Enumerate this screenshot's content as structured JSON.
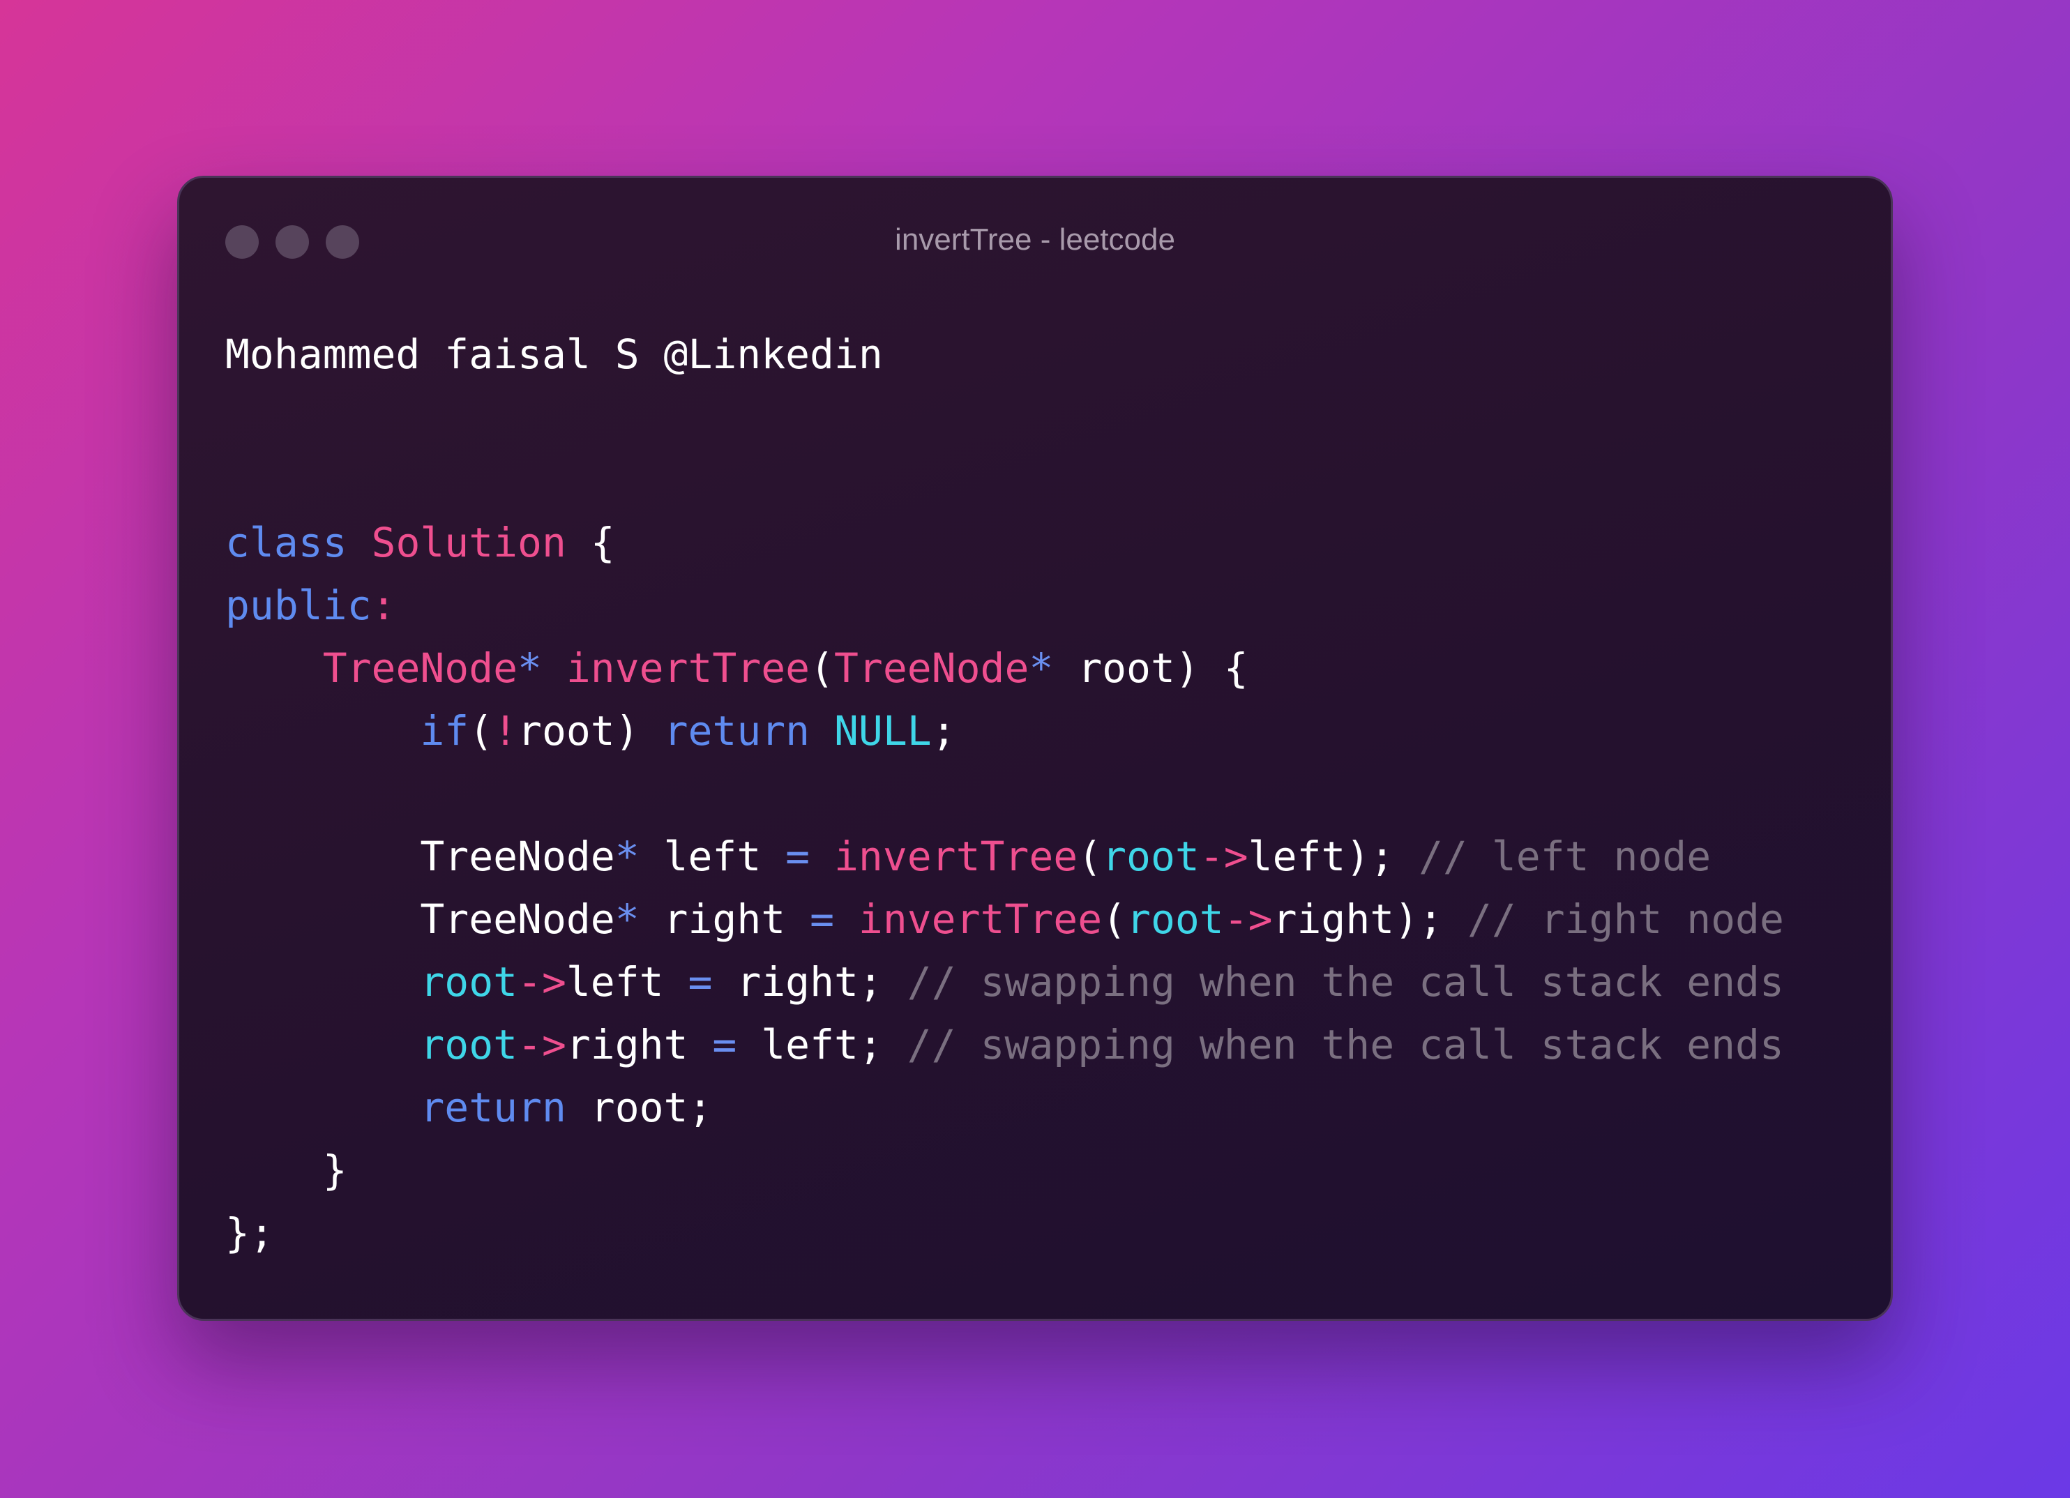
{
  "window": {
    "title": "invertTree - leetcode"
  },
  "colors": {
    "keyword": "#5f8bf0",
    "type": "#ef4f8f",
    "operator": "#6a8ff0",
    "member": "#3fd6e8",
    "comment": "#7a6f80",
    "text": "#ffffff"
  },
  "code": {
    "author_line": "Mohammed faisal S @Linkedin",
    "l1": {
      "kw": "class",
      "name": "Solution",
      "brace": " {"
    },
    "l2": {
      "kw": "public",
      "colon": ":"
    },
    "l3": {
      "type": "TreeNode",
      "star": "*",
      "fn": "invertTree",
      "open": "(",
      "ptype": "TreeNode",
      "pstar": "*",
      "rest": " root) {"
    },
    "l4": {
      "kw_if": "if",
      "open": "(",
      "not": "!",
      "var": "root)",
      "kw_ret": "return",
      "null": "NULL",
      "semi": ";"
    },
    "l5": {
      "type": "TreeNode",
      "star": "*",
      "var": " left ",
      "eq": "=",
      "fn": "invertTree",
      "open": "(",
      "obj": "root",
      "arrow": "->",
      "member": "left);",
      "comment": "// left node"
    },
    "l6": {
      "type": "TreeNode",
      "star": "*",
      "var": " right ",
      "eq": "=",
      "fn": "invertTree",
      "open": "(",
      "obj": "root",
      "arrow": "->",
      "member": "right);",
      "comment": "// right node"
    },
    "l7": {
      "obj": "root",
      "arrow": "->",
      "member": "left ",
      "eq": "=",
      "rest": " right;",
      "comment": "// swapping when the call stack ends"
    },
    "l8": {
      "obj": "root",
      "arrow": "->",
      "member": "right ",
      "eq": "=",
      "rest": " left;",
      "comment": "// swapping when the call stack ends"
    },
    "l9": {
      "kw": "return",
      "rest": " root;"
    },
    "l10": {
      "brace": "}"
    },
    "l11": {
      "brace": "};"
    }
  }
}
